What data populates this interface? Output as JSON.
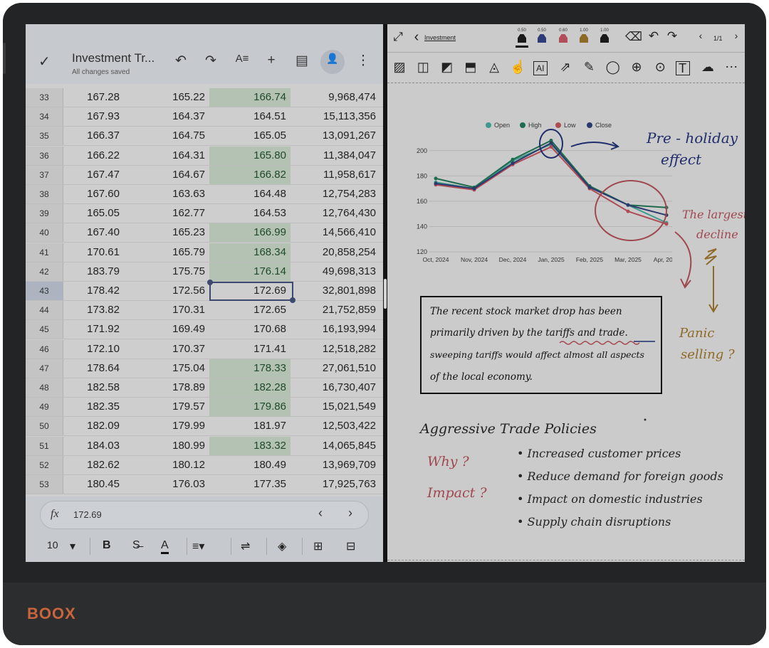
{
  "device": {
    "brand": "BOOX"
  },
  "sheet": {
    "check_icon": "✓",
    "title": "Investment Tr...",
    "status": "All changes saved",
    "toolbar_icons": [
      {
        "name": "undo-icon",
        "glyph": "↶"
      },
      {
        "name": "redo-icon",
        "glyph": "↷"
      },
      {
        "name": "text-format-icon",
        "glyph": "A≡"
      },
      {
        "name": "add-icon",
        "glyph": "+"
      },
      {
        "name": "comment-icon",
        "glyph": "▤"
      },
      {
        "name": "share-icon",
        "glyph": "👤"
      },
      {
        "name": "more-icon",
        "glyph": "⋮"
      }
    ],
    "rows": [
      {
        "n": "33",
        "a": "167.28",
        "b": "165.22",
        "c": "166.74",
        "d": "9,968,474",
        "hl": true
      },
      {
        "n": "34",
        "a": "167.93",
        "b": "164.37",
        "c": "164.51",
        "d": "15,113,356",
        "hl": false
      },
      {
        "n": "35",
        "a": "166.37",
        "b": "164.75",
        "c": "165.05",
        "d": "13,091,267",
        "hl": false
      },
      {
        "n": "36",
        "a": "166.22",
        "b": "164.31",
        "c": "165.80",
        "d": "11,384,047",
        "hl": true
      },
      {
        "n": "37",
        "a": "167.47",
        "b": "164.67",
        "c": "166.82",
        "d": "11,958,617",
        "hl": true
      },
      {
        "n": "38",
        "a": "167.60",
        "b": "163.63",
        "c": "164.48",
        "d": "12,754,283",
        "hl": false
      },
      {
        "n": "39",
        "a": "165.05",
        "b": "162.77",
        "c": "164.53",
        "d": "12,764,430",
        "hl": false
      },
      {
        "n": "40",
        "a": "167.40",
        "b": "165.23",
        "c": "166.99",
        "d": "14,566,410",
        "hl": true
      },
      {
        "n": "41",
        "a": "170.61",
        "b": "165.79",
        "c": "168.34",
        "d": "20,858,254",
        "hl": true
      },
      {
        "n": "42",
        "a": "183.79",
        "b": "175.75",
        "c": "176.14",
        "d": "49,698,313",
        "hl": true
      },
      {
        "n": "43",
        "a": "178.42",
        "b": "172.56",
        "c": "172.69",
        "d": "32,801,898",
        "hl": false,
        "sel": true
      },
      {
        "n": "44",
        "a": "173.82",
        "b": "170.31",
        "c": "172.65",
        "d": "21,752,859",
        "hl": false
      },
      {
        "n": "45",
        "a": "171.92",
        "b": "169.49",
        "c": "170.68",
        "d": "16,193,994",
        "hl": false
      },
      {
        "n": "46",
        "a": "172.10",
        "b": "170.37",
        "c": "171.41",
        "d": "12,518,282",
        "hl": false
      },
      {
        "n": "47",
        "a": "178.64",
        "b": "175.04",
        "c": "178.33",
        "d": "27,061,510",
        "hl": true
      },
      {
        "n": "48",
        "a": "182.58",
        "b": "178.89",
        "c": "182.28",
        "d": "16,730,407",
        "hl": true
      },
      {
        "n": "49",
        "a": "182.35",
        "b": "179.57",
        "c": "179.86",
        "d": "15,021,549",
        "hl": true
      },
      {
        "n": "50",
        "a": "182.09",
        "b": "179.99",
        "c": "181.97",
        "d": "12,503,422",
        "hl": false
      },
      {
        "n": "51",
        "a": "184.03",
        "b": "180.99",
        "c": "183.32",
        "d": "14,065,845",
        "hl": true
      },
      {
        "n": "52",
        "a": "182.62",
        "b": "180.12",
        "c": "180.49",
        "d": "13,969,709",
        "hl": false
      },
      {
        "n": "53",
        "a": "180.45",
        "b": "176.03",
        "c": "177.35",
        "d": "17,925,763",
        "hl": false
      }
    ],
    "formula": {
      "fx": "fx",
      "value": "172.69",
      "prev": "‹",
      "next": "›"
    },
    "format_bar": {
      "font_size": "10",
      "items": [
        {
          "name": "font-size-dropdown-icon",
          "glyph": "▾"
        },
        {
          "name": "bold-button",
          "glyph": "B"
        },
        {
          "name": "strikethrough-button",
          "glyph": "S̶"
        },
        {
          "name": "text-color-button",
          "glyph": "A"
        },
        {
          "name": "align-button",
          "glyph": "≡▾"
        },
        {
          "name": "wrap-button",
          "glyph": "⇌"
        },
        {
          "name": "fill-color-button",
          "glyph": "◈"
        },
        {
          "name": "insert-row-button",
          "glyph": "⊞"
        },
        {
          "name": "insert-column-button",
          "glyph": "⊟"
        }
      ]
    }
  },
  "notes": {
    "doc_name": "Investment",
    "page_indicator": "1/1",
    "pens": [
      {
        "size": "0.50",
        "color": "#1a1a1a",
        "selected": true
      },
      {
        "size": "0.50",
        "color": "#2d3b78",
        "selected": false
      },
      {
        "size": "0.60",
        "color": "#b24e5a",
        "selected": false
      },
      {
        "size": "1.00",
        "color": "#8d6a26",
        "selected": false
      },
      {
        "size": "1.00",
        "color": "#1a1a1a",
        "selected": false
      }
    ],
    "tools_row": [
      "▨",
      "◫",
      "◩",
      "⬒",
      "◬",
      "☝",
      "AI",
      "⇗",
      "✎",
      "◯",
      "⊕",
      "⊙",
      "T",
      "☁",
      "⋯"
    ],
    "chart_data": {
      "type": "line",
      "categories": [
        "Oct, 2024",
        "Nov, 2024",
        "Dec, 2024",
        "Jan, 2025",
        "Feb, 2025",
        "Mar, 2025",
        "Apr, 2025"
      ],
      "series": [
        {
          "name": "Open",
          "color": "#3d9a8c",
          "values": [
            175,
            170,
            192,
            205,
            172,
            157,
            143
          ]
        },
        {
          "name": "High",
          "color": "#1e6b4e",
          "values": [
            178,
            171,
            193,
            208,
            172,
            157,
            155
          ]
        },
        {
          "name": "Low",
          "color": "#b04a55",
          "values": [
            173,
            169,
            189,
            203,
            170,
            152,
            142
          ]
        },
        {
          "name": "Close",
          "color": "#2b3a6e",
          "values": [
            174,
            170,
            190,
            206,
            171,
            157,
            149
          ]
        }
      ],
      "yticks": [
        "200",
        "180",
        "160",
        "140",
        "120"
      ],
      "ylim": [
        120,
        210
      ],
      "legend": "top"
    },
    "annotations": {
      "pre_holiday_1": "Pre - holiday",
      "pre_holiday_2": "effect",
      "largest_1": "The largest",
      "largest_2": "decline",
      "panic_1": "Panic",
      "panic_2": "selling ?",
      "box_lines": [
        "The recent stock market drop has been",
        "primarily driven by the tariffs and trade.",
        "sweeping tariffs would affect almost all aspects",
        "of the local economy."
      ],
      "heading": "Aggressive Trade Policies",
      "why": "Why ?",
      "impact": "Impact ?",
      "bullets": [
        "Increased customer prices",
        "Reduce demand for foreign goods",
        "Impact on domestic industries",
        "Supply chain disruptions"
      ]
    }
  }
}
